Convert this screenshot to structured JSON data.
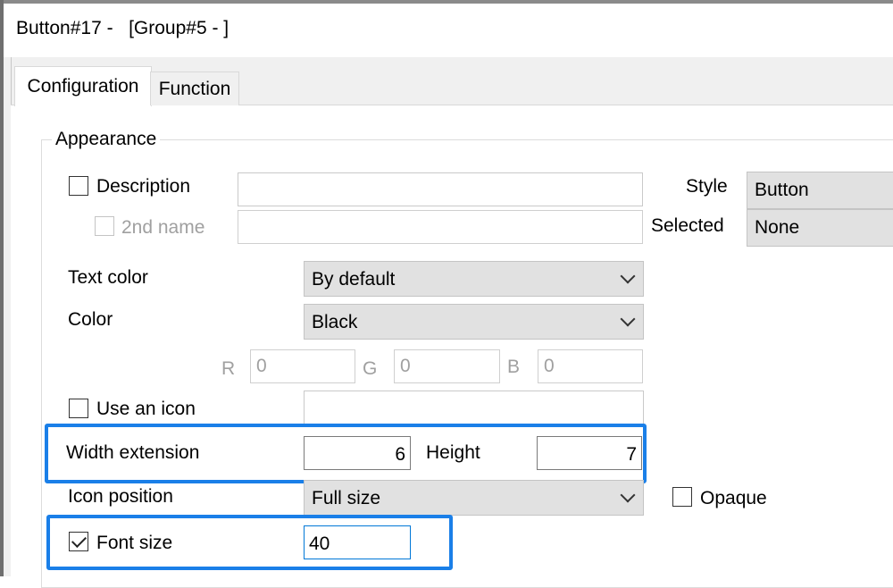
{
  "window": {
    "title": "Button#17 -   [Group#5 - ]"
  },
  "tabs": [
    {
      "label": "Configuration"
    },
    {
      "label": "Function"
    }
  ],
  "appearance": {
    "group_label": "Appearance",
    "description": {
      "label": "Description",
      "value": ""
    },
    "second_name": {
      "label": "2nd name",
      "value": ""
    },
    "style": {
      "label": "Style",
      "value": "Button"
    },
    "selected": {
      "label": "Selected",
      "value": "None"
    },
    "text_color": {
      "label": "Text color",
      "value": "By default"
    },
    "color": {
      "label": "Color",
      "value": "Black"
    },
    "rgb": {
      "r_label": "R",
      "r_value": "0",
      "g_label": "G",
      "g_value": "0",
      "b_label": "B",
      "b_value": "0"
    },
    "use_icon": {
      "label": "Use an icon",
      "value": ""
    },
    "width_extension": {
      "label": "Width extension",
      "value": "6"
    },
    "height": {
      "label": "Height",
      "value": "7"
    },
    "icon_position": {
      "label": "Icon position",
      "value": "Full size"
    },
    "opaque": {
      "label": "Opaque"
    },
    "font_size": {
      "label": "Font size",
      "value": "40"
    }
  },
  "colors": {
    "highlight": "#1a7fe8",
    "focus_border": "#0078d7",
    "combo_bg": "#e1e1e1"
  },
  "state": {
    "description_checked": false,
    "second_name_enabled": false,
    "use_icon_checked": false,
    "opaque_checked": false,
    "font_size_checked": true
  }
}
